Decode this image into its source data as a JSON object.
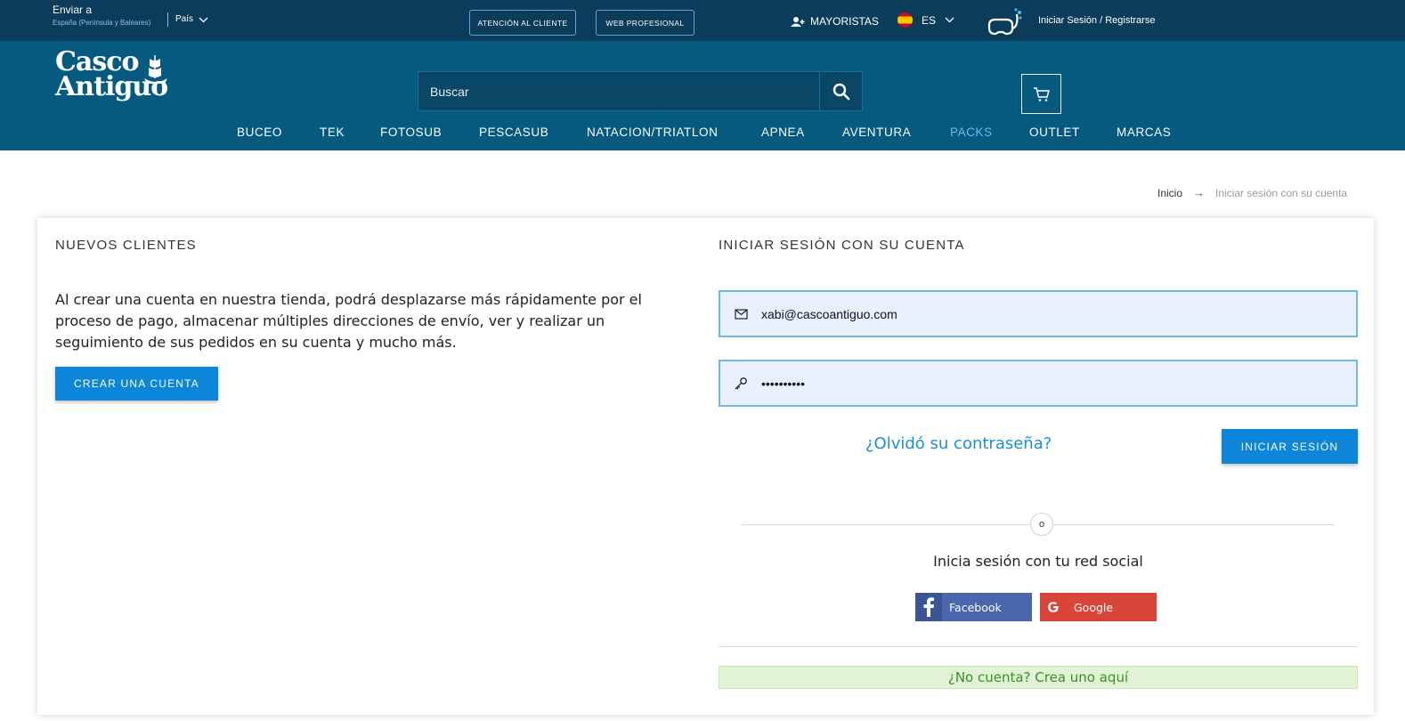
{
  "topbar": {
    "ship_to_label": "Enviar a",
    "ship_to_region": "España (Península y Baleares)",
    "country_label": "País",
    "customer_service": "ATENCIÓN AL CLIENTE",
    "web_profesional": "WEB PROFESIONAL",
    "mayoristas": "MAYORISTAS",
    "language": "ES",
    "login_register": "Iniciar Sesión / Registrarse"
  },
  "header": {
    "logo_line1": "Casco",
    "logo_line2": "Antiguo",
    "search_placeholder": "Buscar"
  },
  "menu": {
    "items": [
      "BUCEO",
      "TEK",
      "FOTOSUB",
      "PESCASUB",
      "NATACION/TRIATLON",
      "APNEA",
      "AVENTURA",
      "PACKS",
      "OUTLET",
      "MARCAS"
    ],
    "active": "PACKS"
  },
  "breadcrumb": {
    "home": "Inicio",
    "separator": "→",
    "current": "Iniciar sesión con su cuenta"
  },
  "new_customers": {
    "title": "NUEVOS CLIENTES",
    "text": "Al crear una cuenta en nuestra tienda, podrá desplazarse más rápidamente por el proceso de pago, almacenar múltiples direcciones de envío, ver y realizar un seguimiento de sus pedidos en su cuenta y mucho más.",
    "create_button": "CREAR UNA CUENTA"
  },
  "login": {
    "title": "INICIAR SESIÓN CON SU CUENTA",
    "email_value": "xabi@cascoantiguo.com",
    "password_value": "••••••••••",
    "forgot_password": "¿Olvidó su contraseña?",
    "submit": "INICIAR SESIÓN",
    "or_label": "o",
    "social_title": "Inicia sesión con tu red social",
    "facebook": "Facebook",
    "google": "Google",
    "no_account": "¿No cuenta? Crea uno aquí"
  },
  "colors": {
    "topbar": "#0b3d5a",
    "header": "#06597f",
    "accent_blue": "#0b86d8",
    "active_menu": "#5fc1ec",
    "facebook": "#4a66ad",
    "google": "#d9453a",
    "success_bg": "#e0f3d4"
  }
}
